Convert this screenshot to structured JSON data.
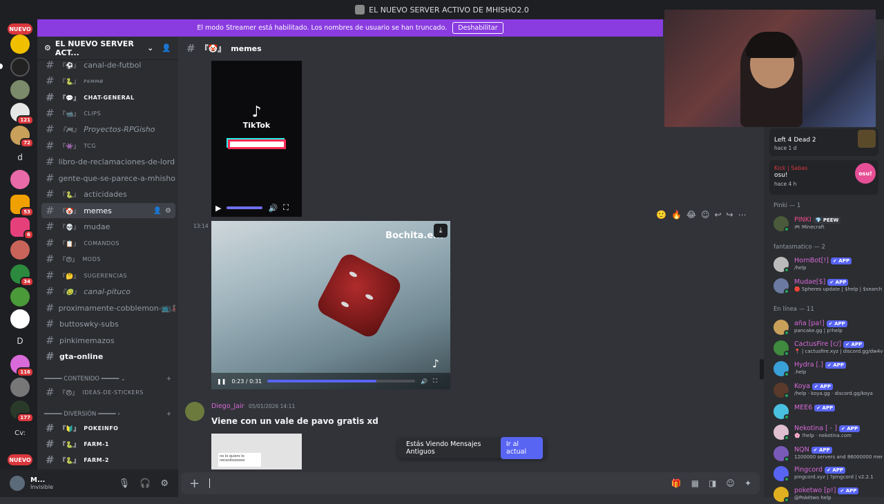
{
  "window": {
    "title": "EL NUEVO SERVER ACTIVO DE MHISHO2.0"
  },
  "banner": {
    "text": "El modo Streamer está habilitado. Los nombres de usuario se han truncado.",
    "button": "Deshabilitar"
  },
  "guilds": {
    "nuevo_label": "NUEVO",
    "badges": [
      "121",
      "72",
      "53",
      "6",
      "34",
      "116",
      "177"
    ],
    "letters": [
      "d",
      "D",
      "Cv:"
    ]
  },
  "server": {
    "name": "EL NUEVO SERVER ACT..."
  },
  "channels": [
    {
      "label": "canal-de-futbol",
      "emoji": "『⚽』"
    },
    {
      "label": "ᴘᴋᴍᴍø",
      "emoji": "『🐍』"
    },
    {
      "label": "CHAT-GENERAL",
      "emoji": "『💬』"
    },
    {
      "label": "CLIPS",
      "emoji": "『📹』"
    },
    {
      "label": "Proyectos-RPGisho",
      "emoji": "『🎮』"
    },
    {
      "label": "TCG",
      "emoji": "『👾』"
    },
    {
      "label": "libro-de-reclamaciones-de-lord-...",
      "emoji": ""
    },
    {
      "label": "gente-que-se-parece-a-mhisho-...",
      "emoji": ""
    },
    {
      "label": "acticidades",
      "emoji": "『🐍』"
    },
    {
      "label": "memes",
      "emoji": "『🤡』"
    },
    {
      "label": "mudae",
      "emoji": "『💀』"
    },
    {
      "label": "COMANDOS",
      "emoji": "『📋』"
    },
    {
      "label": "MODS",
      "emoji": "『😠』"
    },
    {
      "label": "SUGERENCIAS",
      "emoji": "『🤔』"
    },
    {
      "label": "canal-pituco",
      "emoji": "『🤢』"
    },
    {
      "label": "proximamente-cobblemon-📺🎩...",
      "emoji": ""
    },
    {
      "label": "buttoswky-subs",
      "emoji": ""
    },
    {
      "label": "pinkimemazos",
      "emoji": ""
    },
    {
      "label": "gta-online",
      "emoji": ""
    }
  ],
  "categories": [
    {
      "label": "━━━━━ CONTENIDO ━━━━━ ⌄"
    },
    {
      "label": "━━━━━ DIVERSIÓN ━━━━━ ›"
    }
  ],
  "channels2": [
    {
      "label": "IDEAS-DE-STICKERS",
      "emoji": "『😠』"
    },
    {
      "label": "POKEINFO",
      "emoji": "『🔰』"
    },
    {
      "label": "FARM-1",
      "emoji": "『🐍』"
    },
    {
      "label": "FARM-2",
      "emoji": "『🐍』"
    }
  ],
  "user": {
    "name": "M...",
    "status": "Invisible"
  },
  "header": {
    "channel": "memes",
    "emoji": "『🤡』"
  },
  "tiktok": {
    "brand": "TikTok"
  },
  "message1": {
    "time": "13:14"
  },
  "video": {
    "watermark": "Bochita.e...",
    "current": "0:23 / 0:31",
    "progress": 0.74
  },
  "message2": {
    "author": "Diego_Jair",
    "time": "05/01/2026 14:11",
    "text": "Viene con un vale de pavo gratis xd"
  },
  "thumb2": {
    "caption": "no lo quiero lo necesitoooooo"
  },
  "old_messages": {
    "text": "Estás Viendo Mensajes Antiguos",
    "button": "Ir al actual"
  },
  "members": {
    "activities": [
      {
        "name": "Kick | Sabas",
        "title": "Left 4 Dead 2",
        "sub": "hace 1 d"
      },
      {
        "name": "Kick | Sabas",
        "title": "osu!",
        "sub": "hace 4 h",
        "badge": "osu!"
      }
    ],
    "sections": [
      "Pinki — 1",
      "fantasmatico — 2",
      "En línea — 11"
    ],
    "list": [
      {
        "name": "PINKI",
        "tag": "💎 PEEW",
        "status": "🎮 Minecraft",
        "color": "#f14a8c",
        "av": "#4a5a3a"
      },
      {
        "name": "HornBot[!]",
        "tag": "✔ APP",
        "status": "/help",
        "color": "#d96ad9",
        "av": "#bbb"
      },
      {
        "name": "Mudae[$]",
        "tag": "✔ APP",
        "status": "🔴 Spheres update | $help | $search",
        "color": "#d96ad9",
        "av": "#6a7aa0"
      },
      {
        "name": "aña [pa!]",
        "tag": "✔ APP",
        "status": "pancake.gg | p!help",
        "color": "#d96ad9",
        "av": "#c9a05a"
      },
      {
        "name": "CactusFire [c/]",
        "tag": "✔ APP",
        "status": "📍 | cactusfire.xyz | discord.gg/dw4v",
        "color": "#d96ad9",
        "av": "#3f8a3f"
      },
      {
        "name": "Hydra [.]",
        "tag": "✔ APP",
        "status": ".help",
        "color": "#d96ad9",
        "av": "#3aa0d8"
      },
      {
        "name": "Koya",
        "tag": "✔ APP",
        "status": "/help · koya.gg · discord.gg/koya",
        "color": "#d96ad9",
        "av": "#5a3a2a"
      },
      {
        "name": "MEE6",
        "tag": "✔ APP",
        "status": "",
        "color": "#d96ad9",
        "av": "#4ac0e0"
      },
      {
        "name": "Nekotina [ - ]",
        "tag": "✔ APP",
        "status": "🌸 !help · nekotina.com",
        "color": "#d96ad9",
        "av": "#e0c0d0"
      },
      {
        "name": "NQN",
        "tag": "✔ APP",
        "status": "1200000 servers and 86000000 mer",
        "color": "#d96ad9",
        "av": "#7a5ab8"
      },
      {
        "name": "Pingcord",
        "tag": "✔ APP",
        "status": "pingcord.xyz | ?pingcord | v2.2.1",
        "color": "#d96ad9",
        "av": "#5865f2"
      },
      {
        "name": "poketwo [p!]",
        "tag": "✔ APP",
        "status": "@Pokétwo help",
        "color": "#d96ad9",
        "av": "#e0b020"
      }
    ]
  },
  "colors": {
    "banner": "#8a3ce0",
    "accent": "#5865f2",
    "badge": "#da373c"
  }
}
